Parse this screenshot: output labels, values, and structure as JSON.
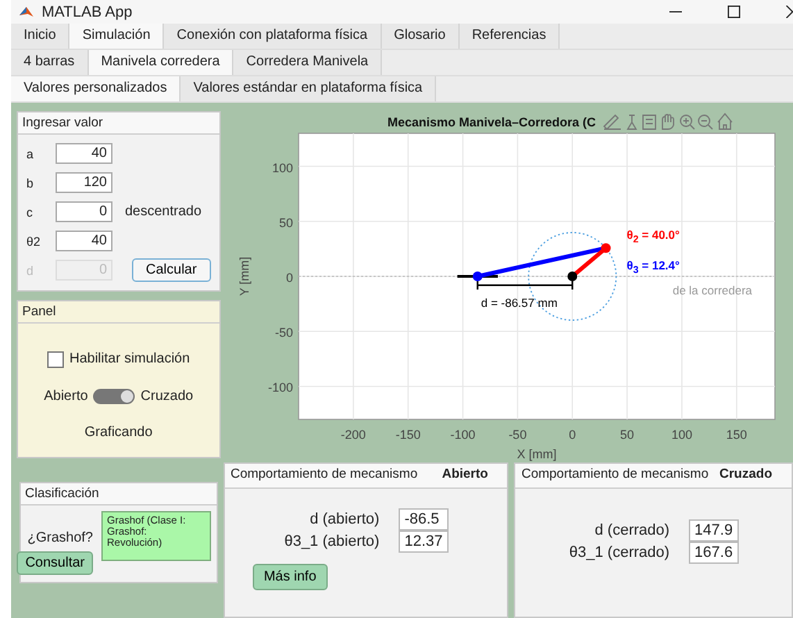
{
  "window": {
    "title": "MATLAB App"
  },
  "tabs": [
    {
      "label": "Inicio",
      "selected": false
    },
    {
      "label": "Simulación",
      "selected": true
    },
    {
      "label": "Conexión con plataforma física",
      "selected": false
    },
    {
      "label": "Glosario",
      "selected": false
    },
    {
      "label": "Referencias",
      "selected": false
    }
  ],
  "subtabs": [
    {
      "label": "4 barras",
      "selected": false
    },
    {
      "label": "Manivela corredera",
      "selected": true
    },
    {
      "label": "Corredera Manivela",
      "selected": false
    }
  ],
  "subsubtabs": [
    {
      "label": "Valores personalizados",
      "selected": true
    },
    {
      "label": "Valores estándar en plataforma física",
      "selected": false
    }
  ],
  "input_panel": {
    "title": "Ingresar valor",
    "fields": [
      {
        "label": "a",
        "value": "40",
        "disabled": false
      },
      {
        "label": "b",
        "value": "120",
        "disabled": false
      },
      {
        "label": "c",
        "value": "0",
        "disabled": false,
        "note": "descentrado"
      },
      {
        "label": "θ2",
        "value": "40",
        "disabled": false
      },
      {
        "label": "d",
        "value": "0",
        "disabled": true
      }
    ],
    "button": "Calcular"
  },
  "sim_panel": {
    "title": "Panel",
    "checkbox": {
      "label": "Habilitar simulación",
      "checked": false
    },
    "switch": {
      "left": "Abierto",
      "right": "Cruzado",
      "on": true
    },
    "status": "Graficando"
  },
  "plot": {
    "title": "Mecanismo Manivela–Corredora (C",
    "xlabel": "X [mm]",
    "ylabel": "Y [mm]",
    "xtick_labels": [
      "-200",
      "-150",
      "-100",
      "-50",
      "0",
      "50",
      "100",
      "150"
    ],
    "ytick_labels": [
      "100",
      "50",
      "0",
      "-50",
      "-100"
    ],
    "annotations": [
      {
        "text": "θ$_{2}$ = 40.0°",
        "color": "#ff0000"
      },
      {
        "text": "θ$_{3}$ = 12.4°",
        "color": "#0000ff"
      },
      {
        "text": "de la corredera",
        "color": "#999999"
      },
      {
        "text": "d = -86.57 mm",
        "color": "#000000"
      }
    ]
  },
  "classification": {
    "title": "Clasificación",
    "question": "¿Grashof?",
    "button": "Consultar",
    "result": [
      "Grashof (Clase I:",
      "Grashof:",
      "Revolución)"
    ]
  },
  "behaviour": [
    {
      "title": "Comportamiento de mecanismo",
      "mode": "Abierto",
      "rows": [
        {
          "label": "d  (abierto)",
          "value": "-86.5"
        },
        {
          "label": "θ3_1 (abierto)",
          "value": "12.37"
        }
      ],
      "button": "Más info"
    },
    {
      "title": "Comportamiento de mecanismo",
      "mode": "Cruzado",
      "rows": [
        {
          "label": "d (cerrado)",
          "value": "147.9"
        },
        {
          "label": "θ3_1 (cerrado)",
          "value": "167.6"
        }
      ]
    }
  ]
}
